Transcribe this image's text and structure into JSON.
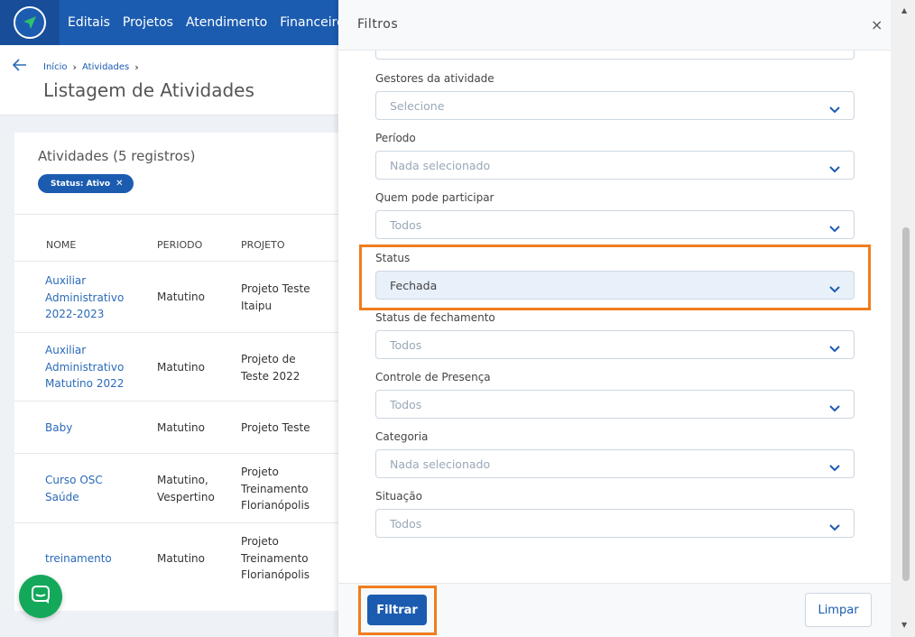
{
  "topbar": {
    "nav": [
      "Editais",
      "Projetos",
      "Atendimento",
      "Financeiro"
    ]
  },
  "breadcrumb": {
    "home": "Início",
    "current": "Atividades",
    "separator": "›"
  },
  "page": {
    "title": "Listagem de Atividades"
  },
  "card": {
    "title": "Atividades (5 registros)",
    "chip": "Status: Ativo",
    "columns": [
      "NOME",
      "PERIODO",
      "PROJETO"
    ],
    "rows": [
      {
        "nome": [
          "Auxiliar",
          "Administrativo",
          "2022-2023"
        ],
        "periodo": [
          "Matutino"
        ],
        "projeto": [
          "Projeto Teste",
          "Itaipu"
        ]
      },
      {
        "nome": [
          "Auxiliar",
          "Administrativo",
          "Matutino 2022"
        ],
        "periodo": [
          "Matutino"
        ],
        "projeto": [
          "Projeto de",
          "Teste 2022"
        ]
      },
      {
        "nome": [
          "Baby"
        ],
        "periodo": [
          "Matutino"
        ],
        "projeto": [
          "Projeto Teste"
        ]
      },
      {
        "nome": [
          "Curso OSC",
          "Saúde"
        ],
        "periodo": [
          "Matutino,",
          "Vespertino"
        ],
        "projeto": [
          "Projeto",
          "Treinamento",
          "Florianópolis"
        ]
      },
      {
        "nome": [
          "treinamento"
        ],
        "periodo": [
          "Matutino"
        ],
        "projeto": [
          "Projeto",
          "Treinamento",
          "Florianópolis"
        ]
      }
    ]
  },
  "panel": {
    "title": "Filtros",
    "close": "×",
    "fields": [
      {
        "label": "Gestores da atividade",
        "value": "Selecione",
        "active": false
      },
      {
        "label": "Período",
        "value": "Nada selecionado",
        "active": false
      },
      {
        "label": "Quem pode participar",
        "value": "Todos",
        "active": false
      },
      {
        "label": "Status",
        "value": "Fechada",
        "active": true
      },
      {
        "label": "Status de fechamento",
        "value": "Todos",
        "active": false
      },
      {
        "label": "Controle de Presença",
        "value": "Todos",
        "active": false
      },
      {
        "label": "Categoria",
        "value": "Nada selecionado",
        "active": false
      },
      {
        "label": "Situação",
        "value": "Todos",
        "active": false
      }
    ],
    "filter_button": "Filtrar",
    "clear_button": "Limpar"
  },
  "colors": {
    "brand": "#1c5cb0",
    "highlight": "#f07d1e",
    "chat": "#14a85b"
  },
  "icons": [
    "logo-icon",
    "back-arrow-icon",
    "chevron-down-icon",
    "close-icon",
    "chat-icon"
  ]
}
